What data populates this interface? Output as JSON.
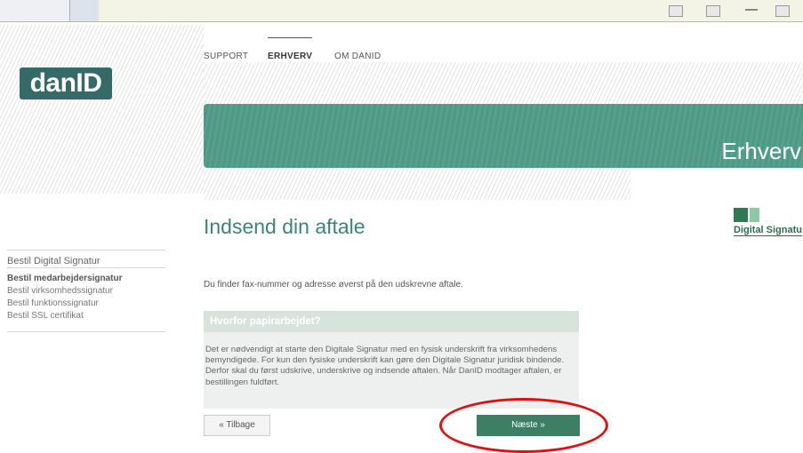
{
  "nav": {
    "items": [
      "SUPPORT",
      "ERHVERV",
      "OM DANID"
    ],
    "active": "ERHVERV"
  },
  "logo": {
    "text": "danID"
  },
  "banner": {
    "title": "Erhverv",
    "color": "#4f9a84"
  },
  "page": {
    "title": "Indsend din aftale"
  },
  "digital_signatur_logo": {
    "text": "Digital Signatu"
  },
  "sidebar": {
    "heading": "Bestil Digital Signatur",
    "items": [
      "Bestil medarbejdersignatur",
      "Bestil virksomhedssignatur",
      "Bestil funktionssignatur",
      "Bestil SSL certifikat"
    ],
    "active": "Bestil medarbejdersignatur"
  },
  "info_text": "Du finder fax-nummer og adresse øverst på den udskrevne aftale.",
  "infobox": {
    "title": "Hvorfor papirarbejdet?",
    "body": "Det er nødvendigt at starte den Digitale Signatur med en fysisk underskrift fra virksomhedens bemyndigede. For kun den fysiske underskrift kan gøre den Digitale Signatur juridisk bindende. Derfor skal du først udskrive, underskrive og indsende aftalen. Når DanID modtager aftalen, er bestillingen fuldført."
  },
  "buttons": {
    "back": "« Tilbage",
    "next": "Næste »"
  },
  "colors": {
    "accent": "#3d7f65",
    "highlight_circle": "#e01010"
  }
}
